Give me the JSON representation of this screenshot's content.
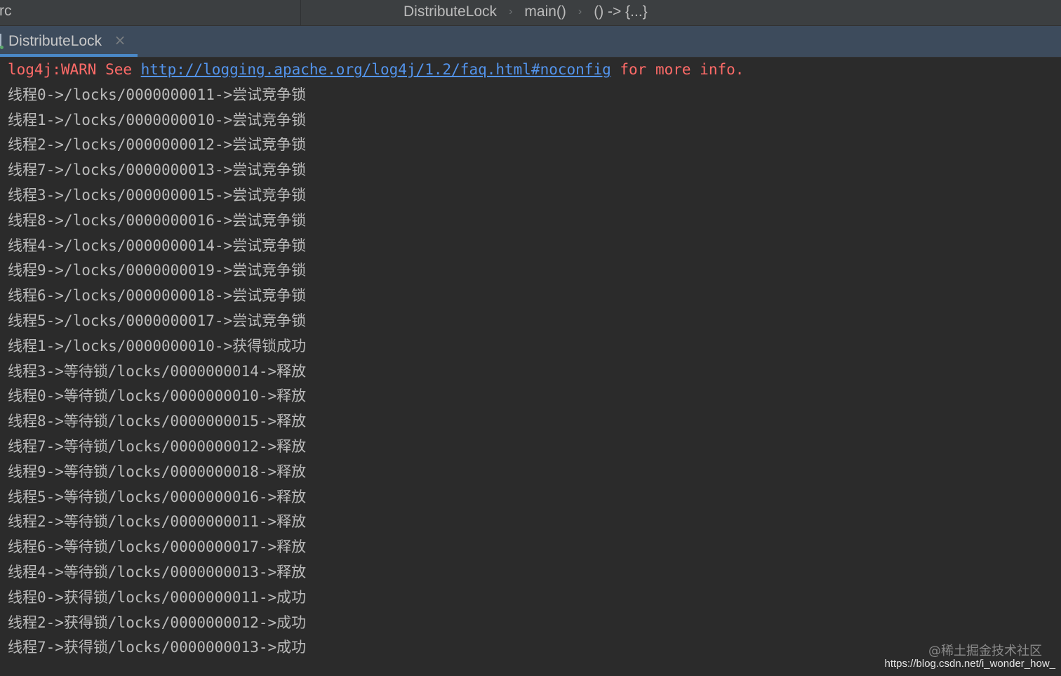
{
  "navbar": {
    "left_fragment": "rc",
    "breadcrumb": [
      "DistributeLock",
      "main()",
      "() -> {...}"
    ],
    "separator": "›"
  },
  "tab": {
    "label": "DistributeLock",
    "close_glyph": "×"
  },
  "console": {
    "warning": {
      "prefix": "log4j:WARN See ",
      "link": "http://logging.apache.org/log4j/1.2/faq.html#noconfig",
      "suffix": " for more info."
    },
    "lines": [
      "线程0->/locks/0000000011->尝试竞争锁",
      "线程1->/locks/0000000010->尝试竞争锁",
      "线程2->/locks/0000000012->尝试竞争锁",
      "线程7->/locks/0000000013->尝试竞争锁",
      "线程3->/locks/0000000015->尝试竞争锁",
      "线程8->/locks/0000000016->尝试竞争锁",
      "线程4->/locks/0000000014->尝试竞争锁",
      "线程9->/locks/0000000019->尝试竞争锁",
      "线程6->/locks/0000000018->尝试竞争锁",
      "线程5->/locks/0000000017->尝试竞争锁",
      "线程1->/locks/0000000010->获得锁成功",
      "线程3->等待锁/locks/0000000014->释放",
      "线程0->等待锁/locks/0000000010->释放",
      "线程8->等待锁/locks/0000000015->释放",
      "线程7->等待锁/locks/0000000012->释放",
      "线程9->等待锁/locks/0000000018->释放",
      "线程5->等待锁/locks/0000000016->释放",
      "线程2->等待锁/locks/0000000011->释放",
      "线程6->等待锁/locks/0000000017->释放",
      "线程4->等待锁/locks/0000000013->释放",
      "线程0->获得锁/locks/0000000011->成功",
      "线程2->获得锁/locks/0000000012->成功",
      "线程7->获得锁/locks/0000000013->成功"
    ]
  },
  "watermark": {
    "site": "@稀土掘金技术社区",
    "url": "https://blog.csdn.net/i_wonder_how_"
  },
  "colors": {
    "background": "#2b2b2b",
    "console_text": "#bbbbbb",
    "warn_text": "#ff6b68",
    "link": "#5394ec",
    "tab_bar": "#3d4b5c",
    "tab_underline": "#4a88c7"
  }
}
